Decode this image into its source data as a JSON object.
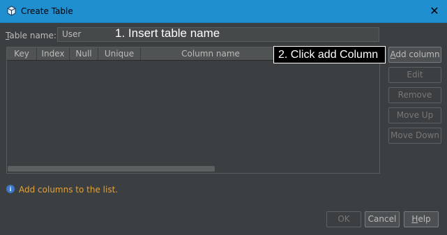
{
  "window": {
    "title": "Create Table",
    "close_icon": "close-icon"
  },
  "form": {
    "table_name_label": "Table name:",
    "table_name_value": "User"
  },
  "table": {
    "columns": [
      "Key",
      "Index",
      "Null",
      "Unique",
      "Column name"
    ],
    "rows": []
  },
  "side_buttons": {
    "add_column": "Add column",
    "edit": "Edit",
    "remove": "Remove",
    "move_up": "Move Up",
    "move_down": "Move Down"
  },
  "annotations": {
    "step1": "1. Insert table name",
    "step2": "2. Click add Column"
  },
  "info": {
    "icon": "info-icon",
    "message": "Add columns to the list."
  },
  "dialog_buttons": {
    "ok": "OK",
    "cancel": "Cancel",
    "help": "Help"
  },
  "colors": {
    "titlebar": "#1f8fd0",
    "background": "#3c3f41",
    "info_text": "#e2a23c"
  }
}
